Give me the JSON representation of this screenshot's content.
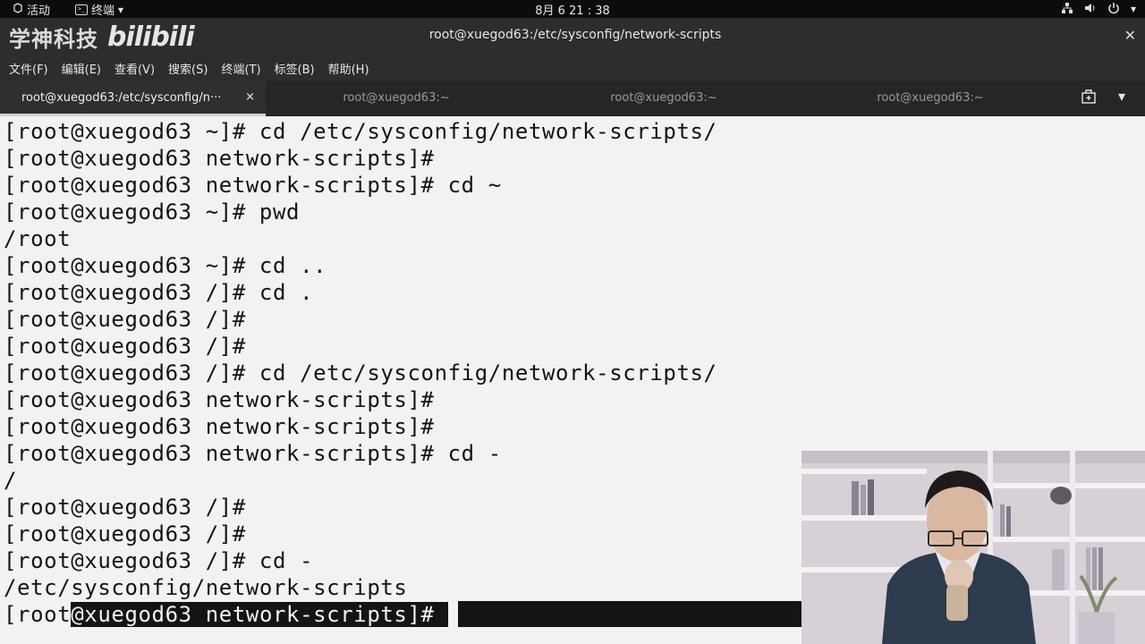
{
  "topbar": {
    "activities": "活动",
    "app_menu": "终端",
    "clock": "8月 6  21 : 38"
  },
  "window": {
    "title": "root@xuegod63:/etc/sysconfig/network-scripts",
    "logo_text": "学神科技",
    "bili_text": "bilibili"
  },
  "menu": {
    "items": [
      "文件(F)",
      "编辑(E)",
      "查看(V)",
      "搜索(S)",
      "终端(T)",
      "标签(B)",
      "帮助(H)"
    ]
  },
  "tabs": [
    {
      "label": "root@xuegod63:/etc/sysconfig/n···",
      "active": true
    },
    {
      "label": "root@xuegod63:~",
      "active": false
    },
    {
      "label": "root@xuegod63:~",
      "active": false
    },
    {
      "label": "root@xuegod63:~",
      "active": false
    }
  ],
  "terminal": {
    "lines": [
      "[root@xuegod63 ~]# cd /etc/sysconfig/network-scripts/",
      "[root@xuegod63 network-scripts]#",
      "[root@xuegod63 network-scripts]# cd ~",
      "[root@xuegod63 ~]# pwd",
      "/root",
      "[root@xuegod63 ~]# cd ..",
      "[root@xuegod63 /]# cd .",
      "[root@xuegod63 /]#",
      "[root@xuegod63 /]#",
      "[root@xuegod63 /]# cd /etc/sysconfig/network-scripts/",
      "[root@xuegod63 network-scripts]#",
      "[root@xuegod63 network-scripts]#",
      "[root@xuegod63 network-scripts]# cd -",
      "/",
      "[root@xuegod63 /]#",
      "[root@xuegod63 /]#",
      "[root@xuegod63 /]# cd -",
      "/etc/sysconfig/network-scripts"
    ],
    "last_prefix": "[root",
    "last_selected": "@xuegod63 network-scripts]# "
  },
  "icons": {
    "network": "network-icon",
    "volume": "volume-icon",
    "power": "power-icon",
    "close": "close-icon",
    "new_tab": "new-tab-icon",
    "tab_menu": "tab-menu-icon"
  },
  "colors": {
    "terminal_bg": "#f2f2f2",
    "terminal_fg": "#141414",
    "chrome": "#2d2d2d",
    "topbar": "#0c0c0c"
  }
}
